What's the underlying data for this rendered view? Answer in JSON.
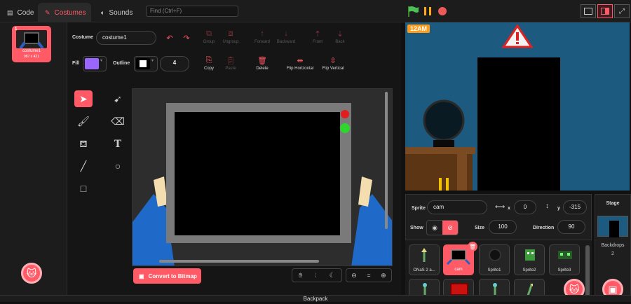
{
  "tabs": {
    "code": "Code",
    "costumes": "Costumes",
    "sounds": "Sounds"
  },
  "find": {
    "placeholder": "Find (Ctrl+F)"
  },
  "costume_list": [
    {
      "index": "1",
      "name": "costume1",
      "size": "987 x 421"
    }
  ],
  "editor": {
    "costume_label": "Costume",
    "costume_name": "costume1",
    "fill_label": "Fill",
    "fill_color": "#9966ff",
    "outline_label": "Outline",
    "outline_color": "#ffffff",
    "outline_width": "4",
    "tools_row1": {
      "group": "Group",
      "ungroup": "Ungroup",
      "forward": "Forward",
      "backward": "Backward",
      "front": "Front",
      "back": "Back"
    },
    "tools_row2": {
      "copy": "Copy",
      "paste": "Paste",
      "delete": "Delete",
      "flip_h": "Flip Horizontal",
      "flip_v": "Flip Vertical"
    },
    "convert_button": "Convert to Bitmap",
    "zoom_reset": "="
  },
  "stage": {
    "badge": "12AM"
  },
  "sprite_info": {
    "sprite_label": "Sprite",
    "sprite_name": "cam",
    "x_label": "x",
    "x_value": "0",
    "y_label": "y",
    "y_value": "-315",
    "show_label": "Show",
    "size_label": "Size",
    "size_value": "100",
    "direction_label": "Direction",
    "direction_value": "90"
  },
  "sprites": [
    {
      "name": "ONaS 2 a..."
    },
    {
      "name": "cam"
    },
    {
      "name": "Sprite1"
    },
    {
      "name": "Sprite2"
    },
    {
      "name": "Sprite3"
    }
  ],
  "stage_panel": {
    "title": "Stage",
    "backdrops_label": "Backdrops",
    "backdrops_count": "2"
  },
  "backpack": "Backpack",
  "colors": {
    "accent": "#ff5a66",
    "stage_bg": "#1d5a80"
  }
}
